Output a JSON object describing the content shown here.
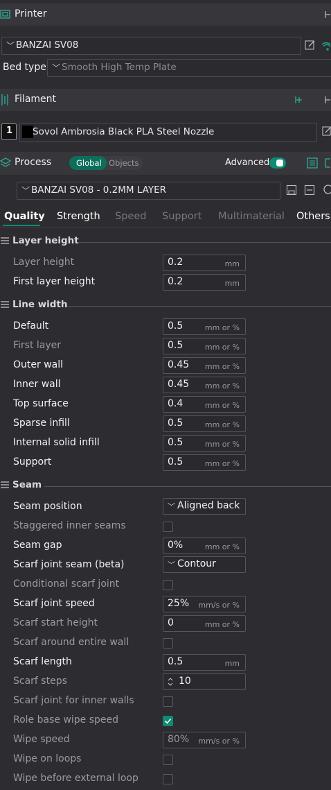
{
  "printer": {
    "title": "Printer",
    "preset": "BANZAI SV08",
    "bed_type_label": "Bed type",
    "bed_type_value": "Smooth High Temp Plate"
  },
  "filament": {
    "title": "Filament",
    "slot_number": "1",
    "name": "Sovol Ambrosia Black PLA Steel Nozzle",
    "color": "#000000"
  },
  "process": {
    "title": "Process",
    "toggle_global": "Global",
    "toggle_objects": "Objects",
    "advanced_label": "Advanced",
    "preset": "BANZAI SV08 - 0.2MM LAYER"
  },
  "tabs": [
    "Quality",
    "Strength",
    "Speed",
    "Support",
    "Multimaterial",
    "Others"
  ],
  "sections": {
    "layer_height": "Layer height",
    "line_width": "Line width",
    "seam": "Seam"
  },
  "layer_height": [
    {
      "label": "Layer height",
      "value": "0.2",
      "unit": "mm"
    },
    {
      "label": "First layer height",
      "value": "0.2",
      "unit": "mm"
    }
  ],
  "line_width": [
    {
      "label": "Default",
      "value": "0.5",
      "unit": "mm or %"
    },
    {
      "label": "First layer",
      "value": "0.5",
      "unit": "mm or %"
    },
    {
      "label": "Outer wall",
      "value": "0.45",
      "unit": "mm or %"
    },
    {
      "label": "Inner wall",
      "value": "0.45",
      "unit": "mm or %"
    },
    {
      "label": "Top surface",
      "value": "0.4",
      "unit": "mm or %"
    },
    {
      "label": "Sparse infill",
      "value": "0.5",
      "unit": "mm or %"
    },
    {
      "label": "Internal solid infill",
      "value": "0.5",
      "unit": "mm or %"
    },
    {
      "label": "Support",
      "value": "0.5",
      "unit": "mm or %"
    }
  ],
  "seam": {
    "seam_position": {
      "label": "Seam position",
      "value": "Aligned back"
    },
    "staggered_inner_seams": {
      "label": "Staggered inner seams",
      "checked": false
    },
    "seam_gap": {
      "label": "Seam gap",
      "value": "0%",
      "unit": "mm or %"
    },
    "scarf_joint_seam": {
      "label": "Scarf joint seam (beta)",
      "value": "Contour"
    },
    "conditional_scarf_joint": {
      "label": "Conditional scarf joint",
      "checked": false
    },
    "scarf_joint_speed": {
      "label": "Scarf joint speed",
      "value": "25%",
      "unit": "mm/s or %"
    },
    "scarf_start_height": {
      "label": "Scarf start height",
      "value": "0",
      "unit": "mm or %"
    },
    "scarf_around_entire_wall": {
      "label": "Scarf around entire wall",
      "checked": false
    },
    "scarf_length": {
      "label": "Scarf length",
      "value": "0.5",
      "unit": "mm"
    },
    "scarf_steps": {
      "label": "Scarf steps",
      "value": "10"
    },
    "scarf_joint_inner_walls": {
      "label": "Scarf joint for inner walls",
      "checked": false
    },
    "role_base_wipe_speed": {
      "label": "Role base wipe speed",
      "checked": true
    },
    "wipe_speed": {
      "label": "Wipe speed",
      "value": "80%",
      "unit": "mm/s or %"
    },
    "wipe_on_loops": {
      "label": "Wipe on loops",
      "checked": false
    },
    "wipe_before_external_loop": {
      "label": "Wipe before external loop",
      "checked": false
    }
  },
  "colors": {
    "accent": "#0f8a73",
    "background": "#2d2d31",
    "header": "#36363b"
  }
}
